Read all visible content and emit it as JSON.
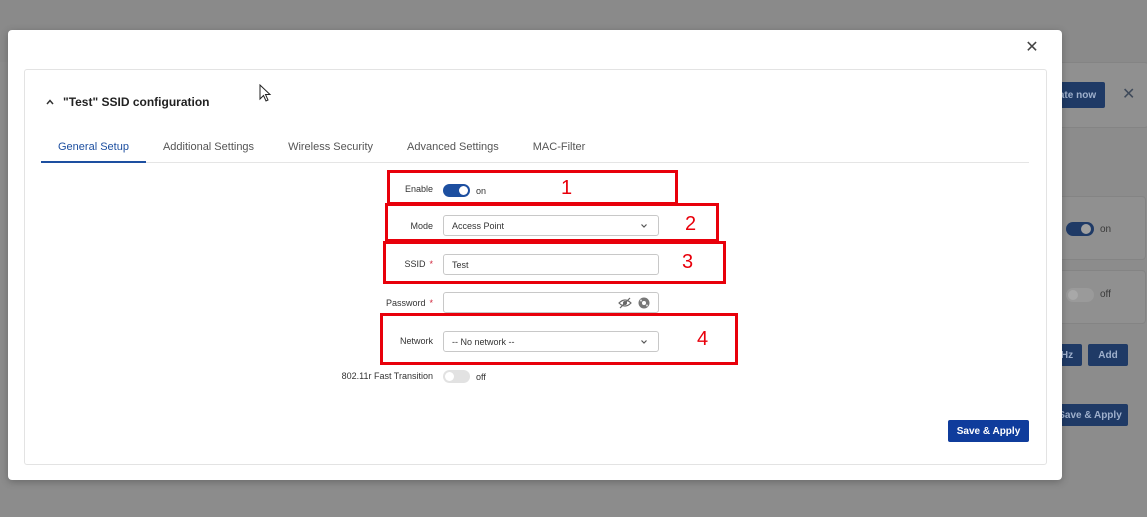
{
  "background": {
    "update_button_label": "ate now",
    "toggle_on_label": "on",
    "toggle_off_label": "off",
    "band_button_label": "Hz",
    "add_button_label": "Add",
    "save_apply_label": "Save & Apply"
  },
  "modal": {
    "panel_title": "\"Test\" SSID configuration",
    "tabs": [
      {
        "label": "General Setup",
        "active": true
      },
      {
        "label": "Additional Settings",
        "active": false
      },
      {
        "label": "Wireless Security",
        "active": false
      },
      {
        "label": "Advanced Settings",
        "active": false
      },
      {
        "label": "MAC-Filter",
        "active": false
      }
    ],
    "form": {
      "enable_label": "Enable",
      "enable_state": "on",
      "mode_label": "Mode",
      "mode_value": "Access Point",
      "ssid_label": "SSID",
      "ssid_value": "Test",
      "password_label": "Password",
      "password_value": "",
      "network_label": "Network",
      "network_value": "-- No network --",
      "fast_transition_label": "802.11r Fast Transition",
      "fast_transition_state": "off",
      "required_marker": "*"
    },
    "save_button_label": "Save & Apply"
  },
  "annotations": [
    "1",
    "2",
    "3",
    "4"
  ],
  "colors": {
    "accent": "#1d4fa0",
    "primary_button": "#0f3c9c",
    "annotation_red": "#e8000b",
    "required_red": "#d0243a"
  }
}
